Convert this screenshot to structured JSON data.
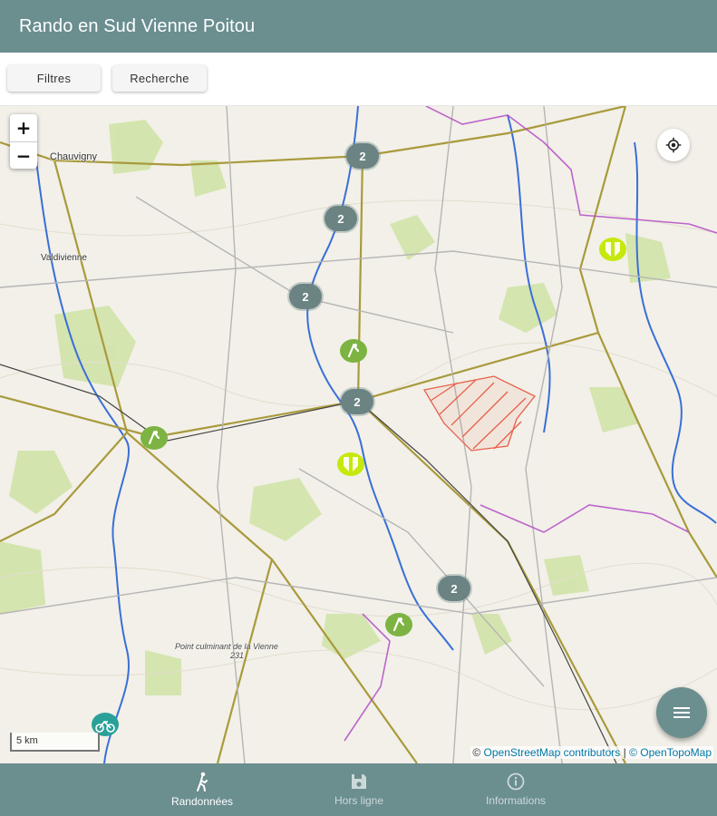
{
  "app": {
    "title": "Rando en Sud Vienne Poitou"
  },
  "toolbar": {
    "filters_label": "Filtres",
    "search_label": "Recherche"
  },
  "map": {
    "zoom_in": "+",
    "zoom_out": "−",
    "scale_label": "5 km",
    "attribution_prefix": "©",
    "attribution_osm": "OpenStreetMap contributors",
    "attribution_sep": "|",
    "attribution_topo": "© OpenTopoMap",
    "places": {
      "chauvigny": "Chauvigny",
      "valdivienne": "Valdivienne",
      "point_culminant": "Point culminant de la Vienne",
      "altitude": "231"
    },
    "clusters": [
      "2",
      "2",
      "2",
      "2",
      "2"
    ],
    "colors": {
      "cluster": "#6b8383",
      "hike_pin": "#7cb342",
      "poi_pin": "#c6e80c",
      "bike_pin": "#2aa198"
    }
  },
  "nav": {
    "items": [
      {
        "label": "Randonnées",
        "icon": "walk-icon",
        "active": true
      },
      {
        "label": "Hors ligne",
        "icon": "save-icon",
        "active": false
      },
      {
        "label": "Informations",
        "icon": "info-icon",
        "active": false
      }
    ]
  },
  "theme": {
    "primary": "#6b8e8f"
  }
}
